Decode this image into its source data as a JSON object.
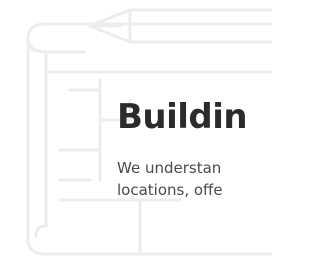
{
  "hero": {
    "title": "Buildin",
    "lines": [
      "We understan",
      "locations, offe"
    ]
  },
  "background": {
    "icon": "blueprint-pencil-icon",
    "stroke_color": "#ececec"
  }
}
